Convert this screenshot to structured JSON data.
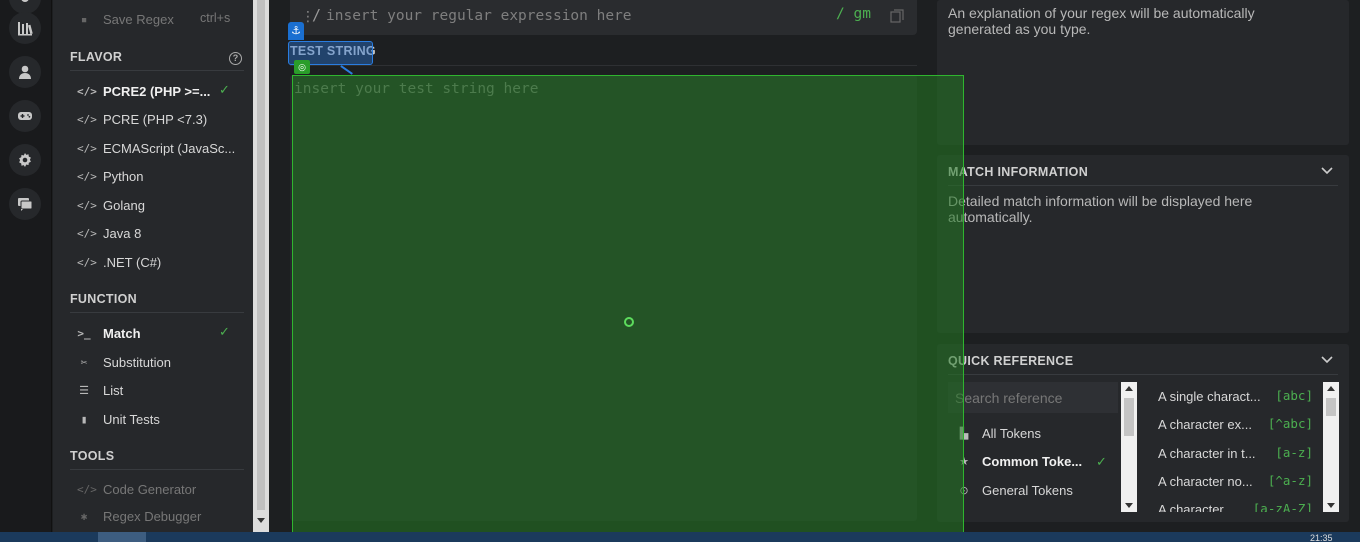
{
  "sidebar": {
    "save_regex": "Save Regex",
    "save_shortcut": "ctrl+s",
    "flavor_title": "FLAVOR",
    "flavors": [
      {
        "label": "PCRE2 (PHP >=...",
        "selected": true
      },
      {
        "label": "PCRE (PHP <7.3)",
        "selected": false
      },
      {
        "label": "ECMAScript (JavaSc...",
        "selected": false
      },
      {
        "label": "Python",
        "selected": false
      },
      {
        "label": "Golang",
        "selected": false
      },
      {
        "label": "Java 8",
        "selected": false
      },
      {
        "label": ".NET (C#)",
        "selected": false
      }
    ],
    "function_title": "FUNCTION",
    "functions": [
      {
        "label": "Match",
        "selected": true
      },
      {
        "label": "Substitution",
        "selected": false
      },
      {
        "label": "List",
        "selected": false
      },
      {
        "label": "Unit Tests",
        "selected": false
      }
    ],
    "tools_title": "TOOLS",
    "tools": [
      {
        "label": "Code Generator"
      },
      {
        "label": "Regex Debugger"
      }
    ]
  },
  "editor": {
    "regex_placeholder": "insert your regular expression here",
    "delimiter": "/",
    "flags": "/ gm",
    "test_string_title": "TEST STRING",
    "test_string_placeholder": "insert your test string here"
  },
  "explanation": {
    "text": "An explanation of your regex will be automatically generated as you type."
  },
  "match_info": {
    "title": "MATCH INFORMATION",
    "text": "Detailed match information will be displayed here automatically."
  },
  "quick_reference": {
    "title": "QUICK REFERENCE",
    "search_placeholder": "Search reference",
    "categories": [
      {
        "label": "All Tokens",
        "selected": false
      },
      {
        "label": "Common Toke...",
        "selected": true
      },
      {
        "label": "General Tokens",
        "selected": false
      }
    ],
    "tokens": [
      {
        "desc": "A single charact...",
        "code": "[abc]"
      },
      {
        "desc": "A character ex...",
        "code": "[^abc]"
      },
      {
        "desc": "A character in t...",
        "code": "[a-z]"
      },
      {
        "desc": "A character no...",
        "code": "[^a-z]"
      },
      {
        "desc": "A character ...",
        "code": "[a-zA-Z]"
      }
    ]
  },
  "taskbar": {
    "clock": "21:35"
  },
  "colors": {
    "accent_green": "#4caf50",
    "overlay_blue": "#2a7de1"
  }
}
